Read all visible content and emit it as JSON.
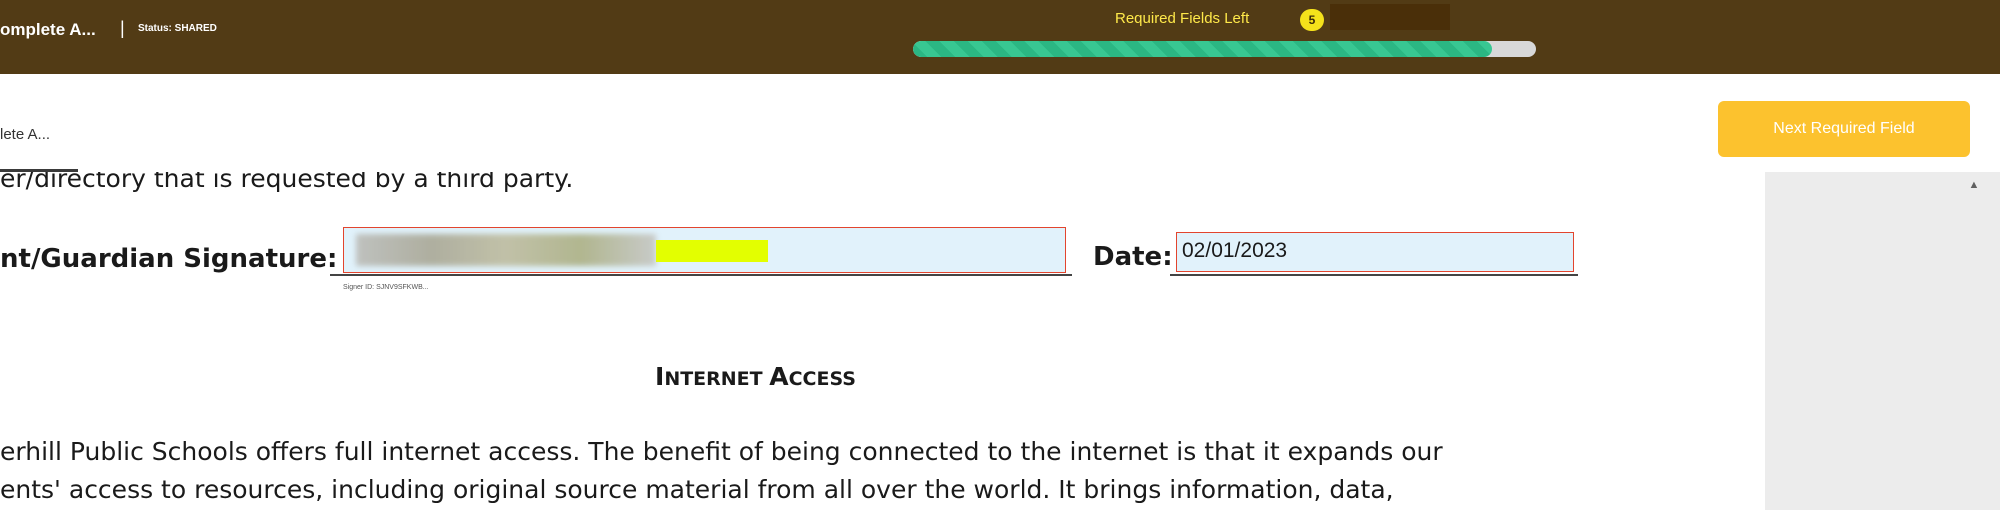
{
  "header": {
    "doc_title": "omplete A...",
    "separator": "|",
    "status_label": "Status: SHARED",
    "required_fields_label": "Required Fields Left",
    "required_fields_count": "5",
    "progress_fraction": 0.93
  },
  "toolbar": {
    "tab_label": "lete A...",
    "next_button_label": "Next Required Field"
  },
  "document": {
    "top_line": "er/directory that is requested by a third party.",
    "signature_label": "nt/Guardian Signature:",
    "signer_id": "Signer ID: SJNV9SFKWB...",
    "date_label": "Date:",
    "date_value": "02/01/2023",
    "section_heading": "Internet Access",
    "paragraph_lines": [
      "erhill Public Schools offers full internet access. The benefit of being connected to the internet is that it expands our",
      "ents' access to resources, including original source material from all over the world. It brings information, data,"
    ]
  },
  "icons": {
    "scroll_up": "scroll-up-arrow-icon"
  },
  "colors": {
    "header_bg": "#523b15",
    "accent_yellow": "#fcc22e",
    "progress_green": "#2bb783",
    "field_bg": "#e1f2fb",
    "field_border": "#e2452e"
  }
}
